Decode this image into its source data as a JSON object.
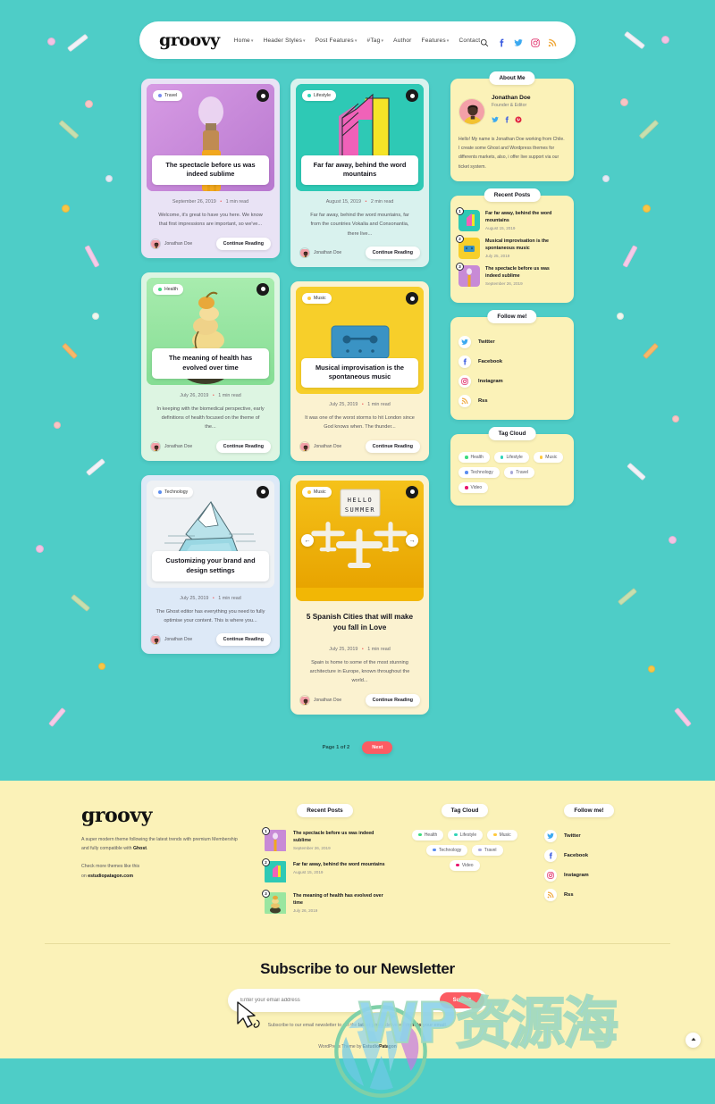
{
  "site": {
    "logo": "groovy",
    "watermark": "WP资源海"
  },
  "nav": {
    "items": [
      {
        "label": "Home",
        "caret": true
      },
      {
        "label": "Header Styles",
        "caret": true
      },
      {
        "label": "Post Features",
        "caret": true
      },
      {
        "label": "#Tag",
        "caret": true
      },
      {
        "label": "Author",
        "caret": false
      },
      {
        "label": "Features",
        "caret": true
      },
      {
        "label": "Contact",
        "caret": false
      }
    ],
    "icons": [
      "search-icon",
      "facebook-icon",
      "twitter-icon",
      "instagram-icon",
      "rss-icon"
    ]
  },
  "posts": [
    {
      "tag": "Travel",
      "tag_color": "#7b8cf0",
      "title": "The spectacle before us was indeed sublime",
      "date": "September 26, 2019",
      "read_time": "1 min read",
      "excerpt": "Welcome, it's great to have you here. We know that first impressions are important, so we've...",
      "author": "Jonathan Doe",
      "cta": "Continue Reading",
      "card_bg": "#e9e3f5",
      "thumb_bg": "#c88ad6"
    },
    {
      "tag": "Lifestyle",
      "tag_color": "#2fd3b8",
      "title": "Far far away, behind the word mountains",
      "date": "August 15, 2019",
      "read_time": "2 min read",
      "excerpt": "Far far away, behind the word mountains, far from the countries Vokalia and Consonantia, there live...",
      "author": "Jonathan Doe",
      "cta": "Continue Reading",
      "card_bg": "#d9f2ee",
      "thumb_bg": "#2ec9b5"
    },
    {
      "tag": "Health",
      "tag_color": "#3ddb7f",
      "title": "The meaning of health has evolved over time",
      "date": "July 26, 2019",
      "read_time": "1 min read",
      "excerpt": "In keeping with the biomedical perspective, early definitions of health focused on the theme of the...",
      "author": "Jonathan Doe",
      "cta": "Continue Reading",
      "card_bg": "#ddf5e2",
      "thumb_bg": "#9ae6a0"
    },
    {
      "tag": "Music",
      "tag_color": "#ffc93c",
      "title": "Musical improvisation is the spontaneous music",
      "date": "July 25, 2019",
      "read_time": "1 min read",
      "excerpt": "It was one of the worst storms to hit London since God knows when. The thunder...",
      "author": "Jonathan Doe",
      "cta": "Continue Reading",
      "card_bg": "#fbf2d0",
      "thumb_bg": "#f7cf2a"
    },
    {
      "tag": "Technology",
      "tag_color": "#5b8def",
      "title": "Customizing your brand and design settings",
      "date": "July 25, 2019",
      "read_time": "1 min read",
      "excerpt": "The Ghost editor has everything you need to fully optimise your content. This is where you...",
      "author": "Jonathan Doe",
      "cta": "Continue Reading",
      "card_bg": "#dde9f7",
      "thumb_bg": "#eef1f4"
    },
    {
      "tag": "Music",
      "tag_color": "#ffc93c",
      "title": "5 Spanish Cities that will make you fall in Love",
      "date": "July 25, 2019",
      "read_time": "1 min read",
      "excerpt": "Spain is home to some of the most stunning architecture in Europe, known throughout the world...",
      "author": "Jonathan Doe",
      "cta": "Continue Reading",
      "card_bg": "#fbf2d0",
      "thumb_bg": "#f2b705",
      "slider": {
        "prev": "←",
        "next": "→",
        "sign_line1": "HELLO",
        "sign_line2": "SUMMER"
      }
    }
  ],
  "sidebar": {
    "about": {
      "title": "About Me",
      "name": "Jonathan Doe",
      "role": "Founder & Editor",
      "socials": [
        "twitter-icon",
        "facebook-icon",
        "pinterest-icon"
      ],
      "bio": "Hello! My name is Jonathan Doe working from Chile. I create some Ghost and Wordpress themes for differents markets, also, i offer live support via our ticket system."
    },
    "recent_posts": {
      "title": "Recent Posts",
      "items": [
        {
          "num": "1",
          "title": "Far far away, behind the word mountains",
          "date": "August 15, 2019",
          "thumb_bg": "#2ec9b5"
        },
        {
          "num": "2",
          "title": "Musical improvisation is the spontaneous music",
          "date": "July 25, 2019",
          "thumb_bg": "#f7cf2a"
        },
        {
          "num": "3",
          "title": "The spectacle before us was indeed sublime",
          "date": "September 26, 2019",
          "thumb_bg": "#c88ad6"
        }
      ]
    },
    "follow": {
      "title": "Follow me!",
      "items": [
        {
          "label": "Twitter",
          "icon": "twitter-icon",
          "color": "#3ba9f0"
        },
        {
          "label": "Facebook",
          "icon": "facebook-icon",
          "color": "#3b5ce0"
        },
        {
          "label": "Instagram",
          "icon": "instagram-icon",
          "color": "#e1306c"
        },
        {
          "label": "Rss",
          "icon": "rss-icon",
          "color": "#f0a93b"
        }
      ]
    },
    "tag_cloud": {
      "title": "Tag Cloud",
      "tags": [
        {
          "label": "Health",
          "color": "#3ddb7f"
        },
        {
          "label": "Lifestyle",
          "color": "#2fd3b8"
        },
        {
          "label": "Music",
          "color": "#ffc93c"
        },
        {
          "label": "Technology",
          "color": "#5b8def"
        },
        {
          "label": "Travel",
          "color": "#a8a8d8"
        },
        {
          "label": "Video",
          "color": "#e8156e"
        }
      ]
    }
  },
  "pagination": {
    "label": "Page 1 of 2",
    "next": "Next"
  },
  "footer": {
    "logo": "groovy",
    "description_1": "A super modern theme following the latest trends with premium Membership and fully compatible with ",
    "description_brand": "Ghost",
    "description_1_end": ".",
    "description_2": "Check more themes like this",
    "description_3_prefix": "on ",
    "description_3_link": "estudiopatagon.com",
    "recent_posts": {
      "title": "Recent Posts",
      "items": [
        {
          "num": "1",
          "title": "The spectacle before us was indeed sublime",
          "date": "September 26, 2019",
          "thumb_bg": "#c88ad6"
        },
        {
          "num": "2",
          "title": "Far far away, behind the word mountains",
          "date": "August 15, 2019",
          "thumb_bg": "#2ec9b5"
        },
        {
          "num": "3",
          "title": "The meaning of health has evolved over time",
          "date": "July 26, 2019",
          "thumb_bg": "#9ae6a0"
        }
      ]
    },
    "tag_cloud": {
      "title": "Tag Cloud",
      "tags": [
        {
          "label": "Health",
          "color": "#3ddb7f"
        },
        {
          "label": "Lifestyle",
          "color": "#2fd3b8"
        },
        {
          "label": "Music",
          "color": "#ffc93c"
        },
        {
          "label": "Technology",
          "color": "#5b8def"
        },
        {
          "label": "Travel",
          "color": "#a8a8d8"
        },
        {
          "label": "Video",
          "color": "#e8156e"
        }
      ]
    },
    "follow": {
      "title": "Follow me!",
      "items": [
        {
          "label": "Twitter",
          "icon": "twitter-icon",
          "color": "#3ba9f0"
        },
        {
          "label": "Facebook",
          "icon": "facebook-icon",
          "color": "#3b5ce0"
        },
        {
          "label": "Instagram",
          "icon": "instagram-icon",
          "color": "#e1306c"
        },
        {
          "label": "Rss",
          "icon": "rss-icon",
          "color": "#f0a93b"
        }
      ]
    },
    "newsletter": {
      "title": "Subscribe to our Newsletter",
      "placeholder": "Enter your email address",
      "submit": "Submit",
      "note_1": "Subscribe to our email newsletter to get the ",
      "note_bold_1": "latest posts",
      "note_2": " delivered ",
      "note_bold_2": "right to your email",
      "note_3": "."
    },
    "copyright_prefix": "WordPress Theme by ",
    "copyright_brand": "EstudioPatagon"
  },
  "colors": {
    "background": "#4ecdc7",
    "cream": "#fbf2b8",
    "accent_red": "#fc5c63"
  }
}
